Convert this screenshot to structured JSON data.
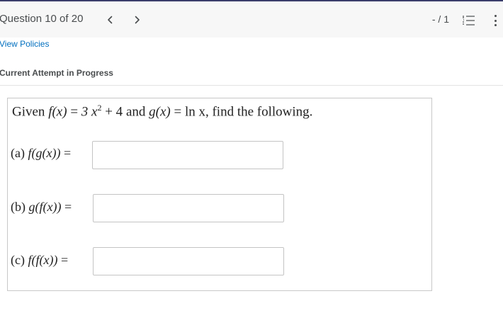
{
  "header": {
    "question_counter": "Question 10 of 20",
    "score": "- / 1"
  },
  "links": {
    "view_policies": "View Policies"
  },
  "attempt_status": "Current Attempt in Progress",
  "question": {
    "intro": {
      "given": "Given",
      "f_def_lhs": "f(x)",
      "eq": "=",
      "f_def_rhs_a": "3 x",
      "f_exp": "2",
      "f_def_rhs_b": "+ 4",
      "and": "and",
      "g_def_lhs": "g(x)",
      "g_def_rhs": "ln x,",
      "tail": "find the following."
    },
    "parts": [
      {
        "label": "(a)",
        "expr": "f(g(x))",
        "eq": "=",
        "value": ""
      },
      {
        "label": "(b)",
        "expr": "g(f(x))",
        "eq": "=",
        "value": ""
      },
      {
        "label": "(c)",
        "expr": "f(f(x))",
        "eq": "=",
        "value": ""
      }
    ]
  },
  "colors": {
    "top_border": "#3a3d6b",
    "header_bg": "#f7f7f7",
    "link": "#006fbf",
    "text": "#494c4e"
  },
  "icons": [
    "chevron-left-icon",
    "chevron-right-icon",
    "numbered-list-icon",
    "more-vertical-icon"
  ]
}
